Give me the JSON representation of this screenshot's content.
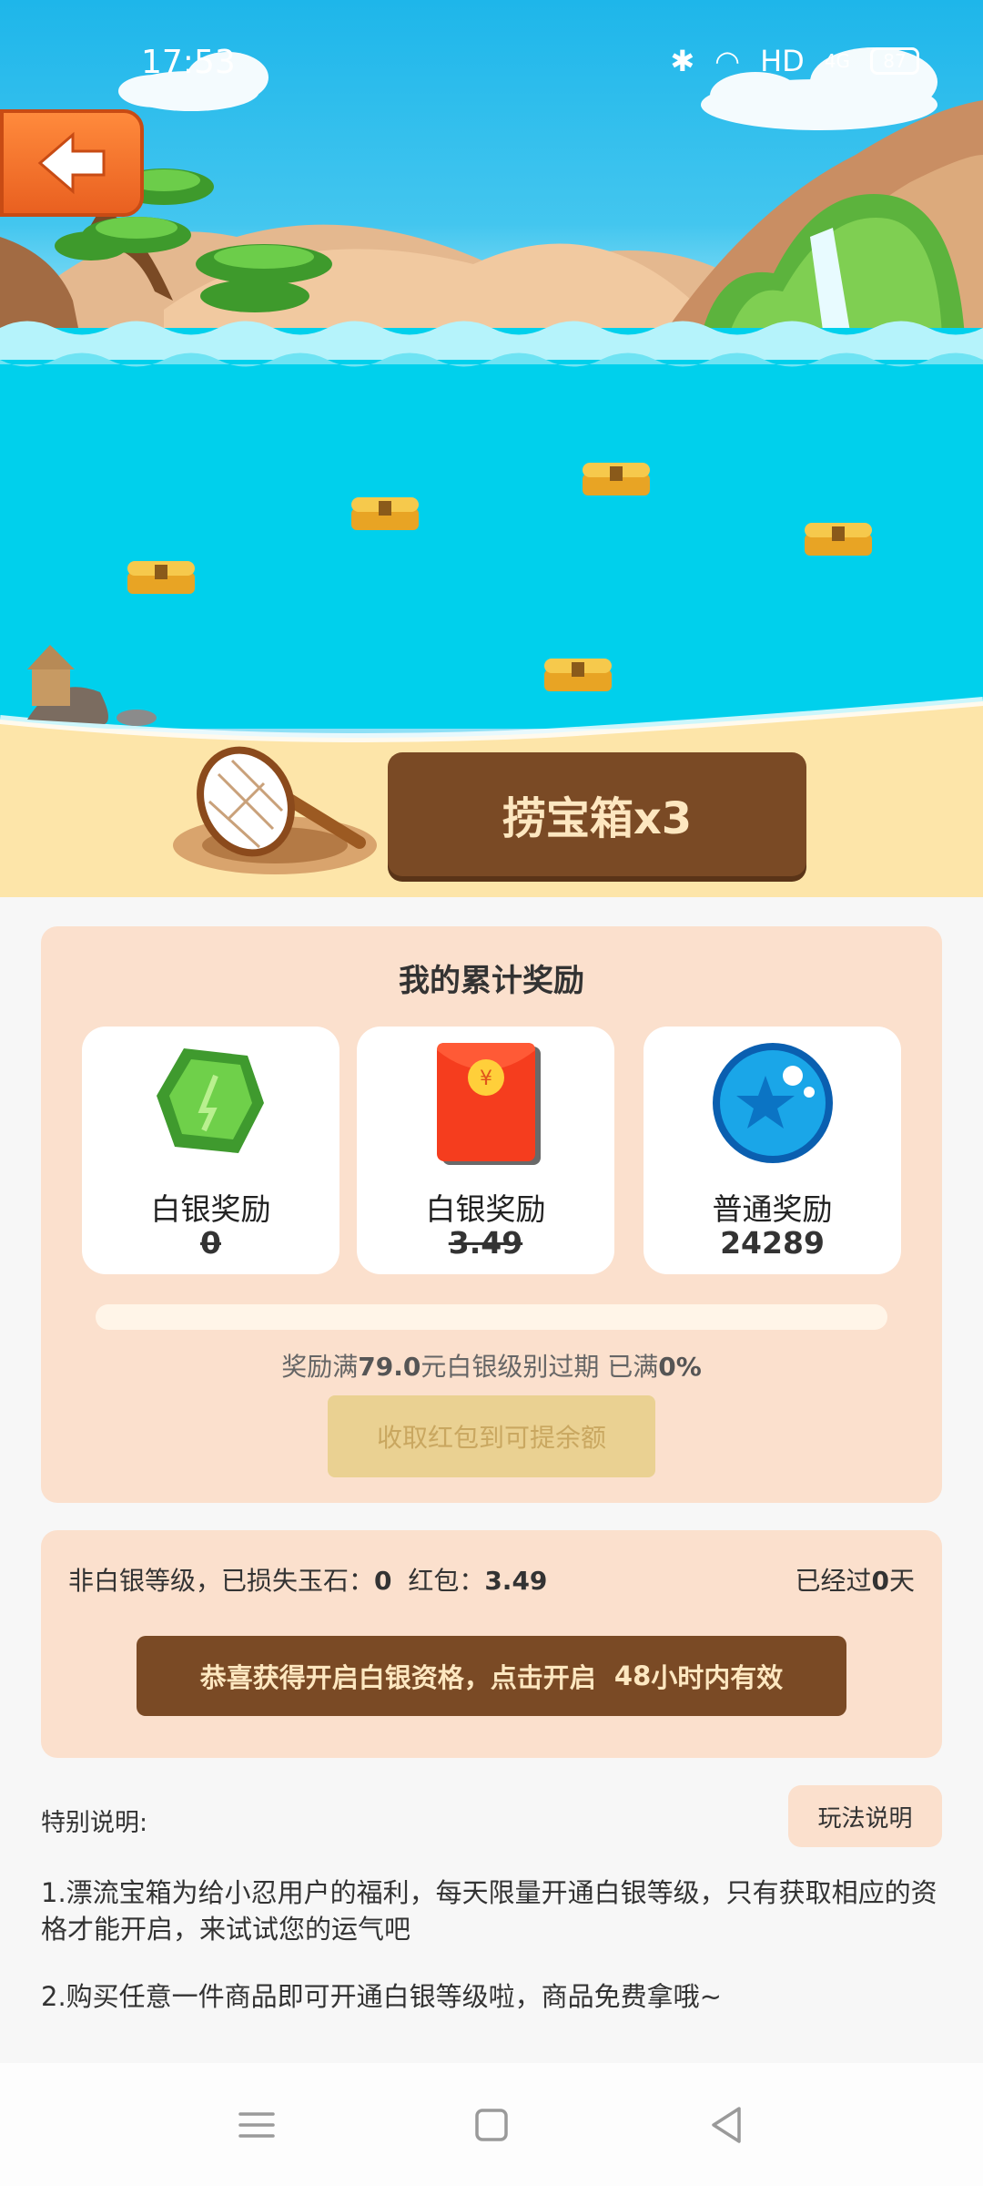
{
  "status_bar": {
    "time": "17:53",
    "network": "HD",
    "signal": "4G",
    "battery": "87"
  },
  "action_button": "捞宝箱x3",
  "rewards": {
    "title": "我的累计奖励",
    "items": [
      {
        "name": "白银奖励",
        "value": "0",
        "struck": true,
        "icon": "jade-stone-icon"
      },
      {
        "name": "白银奖励",
        "value": "3.49",
        "struck": true,
        "icon": "red-envelope-icon"
      },
      {
        "name": "普通奖励",
        "value": "24289",
        "struck": false,
        "icon": "blue-orb-icon"
      }
    ],
    "progress_fraction": 0,
    "rule_prefix": "奖励满",
    "rule_amount": "79.0",
    "rule_middle": "元白银级别过期 已满",
    "rule_percent": "0%",
    "collect_button": "收取红包到可提余额"
  },
  "status": {
    "lost_label": "非白银等级，已损失玉石：",
    "lost_value": "0",
    "red_packet_label": "红包：",
    "red_packet_value": "3.49",
    "days_prefix": "已经过",
    "days_value": "0",
    "days_suffix": "天",
    "open_button_prefix": "恭喜获得开启白银资格，点击开启",
    "open_button_hours": "48",
    "open_button_suffix": "小时内有效"
  },
  "notes": {
    "label": "特别说明:",
    "how_to_button": "玩法说明",
    "note1": "1.漂流宝箱为给小忍用户的福利，每天限量开通白银等级，只有获取相应的资格才能开启，来试试您的运气吧",
    "note2": "2.购买任意一件商品即可开通白银等级啦，商品免费拿哦~"
  },
  "colors": {
    "accent_brown": "#7a4a25",
    "card_bg": "#fbe0cd",
    "back_orange": "#ee6d28",
    "sea": "#00d0ec"
  }
}
